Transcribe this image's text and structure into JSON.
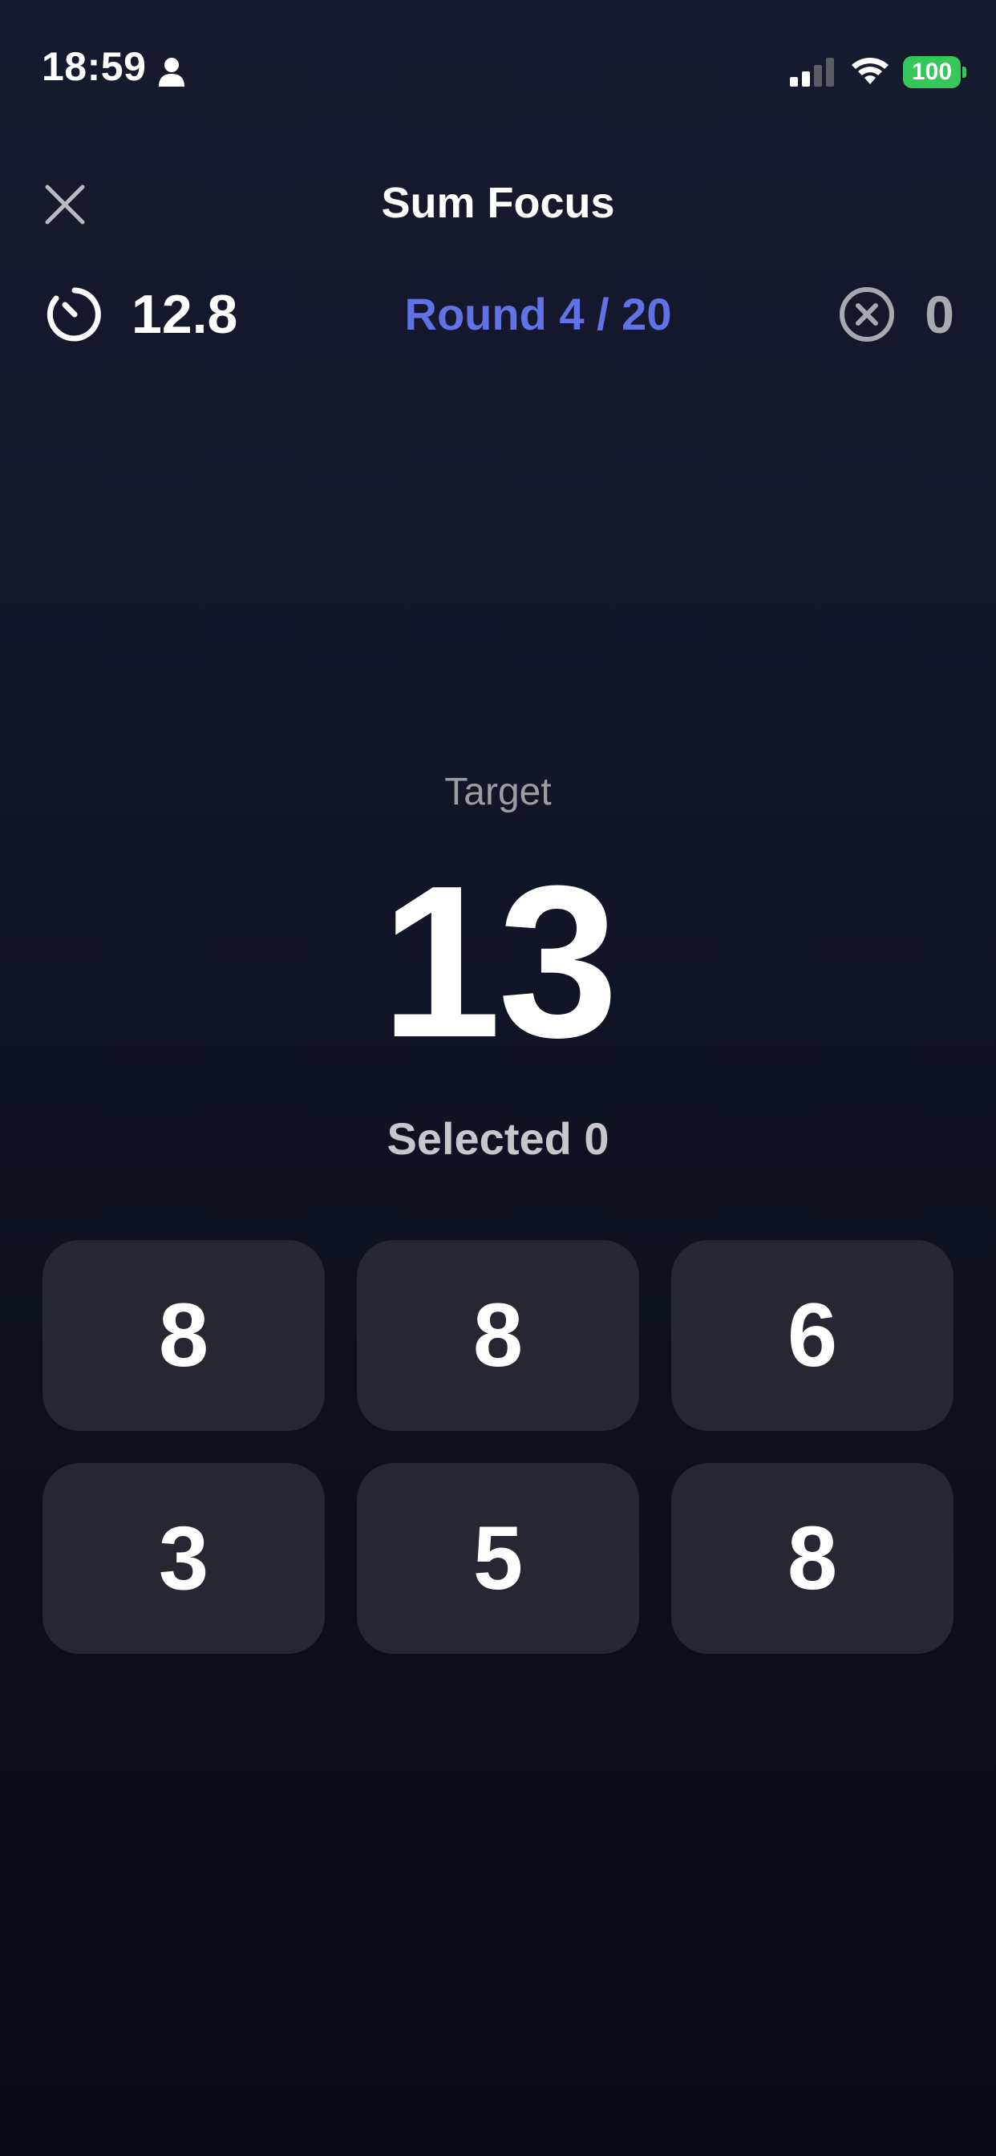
{
  "status_bar": {
    "time": "18:59",
    "battery": "100"
  },
  "header": {
    "title": "Sum Focus"
  },
  "stats": {
    "timer": "12.8",
    "round": "Round 4 / 20",
    "errors": "0"
  },
  "target": {
    "label": "Target",
    "value": "13"
  },
  "selected": {
    "text": "Selected 0"
  },
  "numbers": [
    "8",
    "8",
    "6",
    "3",
    "5",
    "8"
  ],
  "colors": {
    "accent": "#6172e6",
    "tile": "#262733",
    "battery": "#34c759",
    "muted": "#9b9ca4"
  },
  "icons": {
    "close": "close-icon",
    "timer": "stopwatch-icon",
    "errors": "x-circle-icon"
  }
}
